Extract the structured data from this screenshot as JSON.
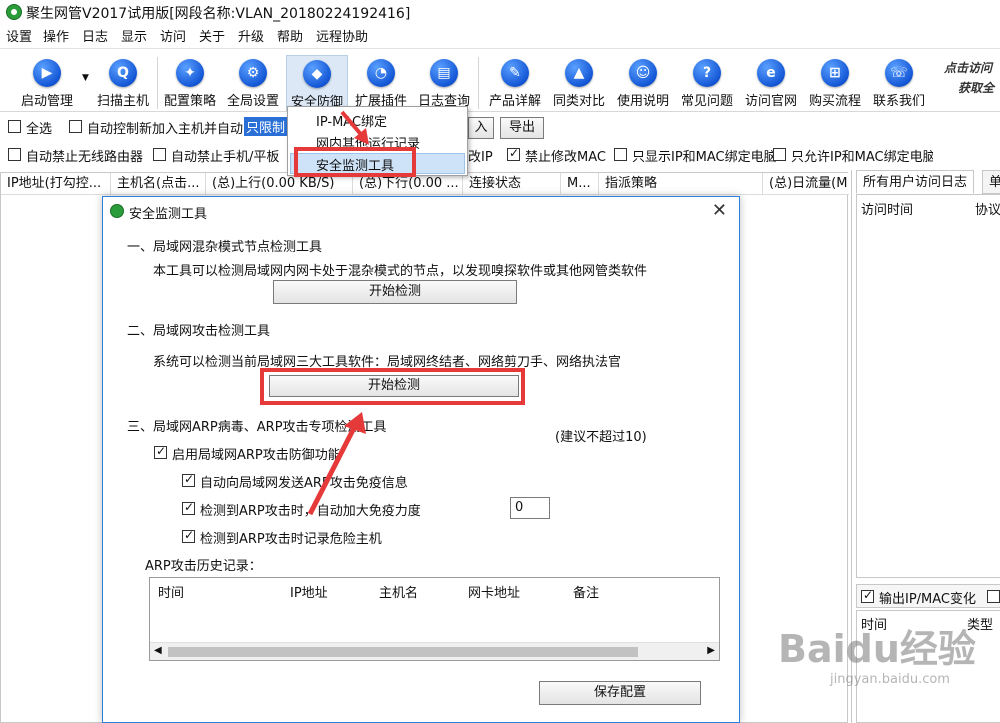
{
  "window": {
    "title": "聚生网管V2017试用版[网段名称:VLAN_20180224192416]"
  },
  "menu": [
    "设置",
    "操作",
    "日志",
    "显示",
    "访问",
    "关于",
    "升级",
    "帮助",
    "远程协助"
  ],
  "toolbar": {
    "buttons": [
      "启动管理",
      "扫描主机",
      "配置策略",
      "全局设置",
      "安全防御",
      "扩展插件",
      "日志查询",
      "产品详解",
      "同类对比",
      "使用说明",
      "常见问题",
      "访问官网",
      "购买流程",
      "联系我们"
    ],
    "promo_line1": "点击访问",
    "promo_line2": "获取全"
  },
  "options_row1": {
    "select_all": "全选",
    "auto_control": "自动控制新加入主机并自动",
    "limit_field": "只限制",
    "import_tail": "入",
    "export": "导出"
  },
  "options_row2": {
    "block_router": "自动禁止无线路由器",
    "block_phone": "自动禁止手机/平板",
    "change_ip_tail": "改IP",
    "block_mac": "禁止修改MAC",
    "show_bound": "只显示IP和MAC绑定电脑",
    "allow_bound": "只允许IP和MAC绑定电脑"
  },
  "main_table": {
    "columns": [
      "IP地址(打勾控...",
      "主机名(点击...",
      "(总)上行(0.00 KB/S)",
      "(总)下行(0.00 ...",
      "连接状态",
      "M...",
      "指派策略",
      "(总)日流量(M"
    ]
  },
  "right_panel": {
    "tabs": [
      "所有用户访问日志",
      "单"
    ],
    "columns": [
      "访问时间",
      "协议"
    ],
    "bottom_checks": [
      "输出IP/MAC变化"
    ],
    "bottom_columns": [
      "时间",
      "类型"
    ]
  },
  "dropdown": {
    "items": [
      "IP-MAC绑定",
      "网内其他运行记录",
      "安全监测工具"
    ]
  },
  "dialog": {
    "title": "安全监测工具",
    "section1_title": "一、局域网混杂模式节点检测工具",
    "section1_desc": "本工具可以检测局域网内网卡处于混杂模式的节点，以发现嗅探软件或其他网管类软件",
    "section1_button": "开始检测",
    "section2_title": "二、局域网攻击检测工具",
    "section2_desc": "系统可以检测当前局域网三大工具软件：局域网终结者、网络剪刀手、网络执法官",
    "section2_button": "开始检测",
    "section3_title": "三、局域网ARP病毒、ARP攻击专项检测工具",
    "section3_note": "(建议不超过10)",
    "enable_defense": "启用局域网ARP攻击防御功能",
    "auto_send": "自动向局域网发送ARP攻击免疫信息",
    "auto_boost": "检测到ARP攻击时，自动加大免疫力度",
    "boost_value": "0",
    "record_host": "检测到ARP攻击时记录危险主机",
    "history_label": "ARP攻击历史记录：",
    "history_columns": [
      "时间",
      "IP地址",
      "主机名",
      "网卡地址",
      "备注"
    ],
    "save_button": "保存配置"
  },
  "watermark": {
    "text": "Baidu经验",
    "sub": "jingyan.baidu.com"
  },
  "colors": {
    "accent": "#2e7fd8",
    "highlight": "#e63a3a",
    "selection": "#cfe3f8"
  }
}
